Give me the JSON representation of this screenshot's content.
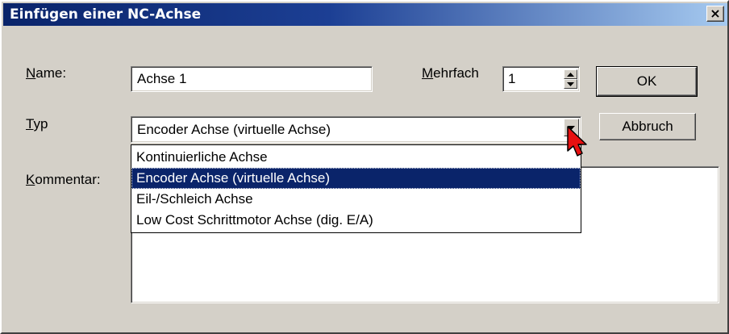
{
  "window": {
    "title": "Einfügen einer NC-Achse",
    "close_symbol": "×"
  },
  "name_field": {
    "label_mnemonic": "N",
    "label_rest": "ame:",
    "value": "Achse 1"
  },
  "mehrfach": {
    "label_mnemonic": "M",
    "label_rest": "ehrfach",
    "value": "1"
  },
  "typ": {
    "label_mnemonic": "T",
    "label_rest": "yp",
    "selected_value": "Encoder Achse (virtuelle Achse)",
    "options": [
      "Kontinuierliche Achse",
      "Encoder Achse (virtuelle Achse)",
      "Eil-/Schleich Achse",
      "Low Cost Schrittmotor Achse (dig. E/A)"
    ],
    "highlighted_index": 1
  },
  "kommentar": {
    "label_mnemonic": "K",
    "label_rest": "ommentar:",
    "value": ""
  },
  "buttons": {
    "ok": "OK",
    "cancel": "Abbruch"
  },
  "colors": {
    "title_bar_start": "#0a246a",
    "title_bar_end": "#a6caf0",
    "dialog_face": "#d4d0c8",
    "selection": "#0a246a",
    "cursor": "#e81010"
  },
  "icons": {
    "close": "close-icon",
    "spin_up": "spin-up-arrow-icon",
    "spin_down": "spin-down-arrow-icon",
    "dropdown": "dropdown-arrow-icon",
    "cursor": "mouse-pointer-icon"
  }
}
